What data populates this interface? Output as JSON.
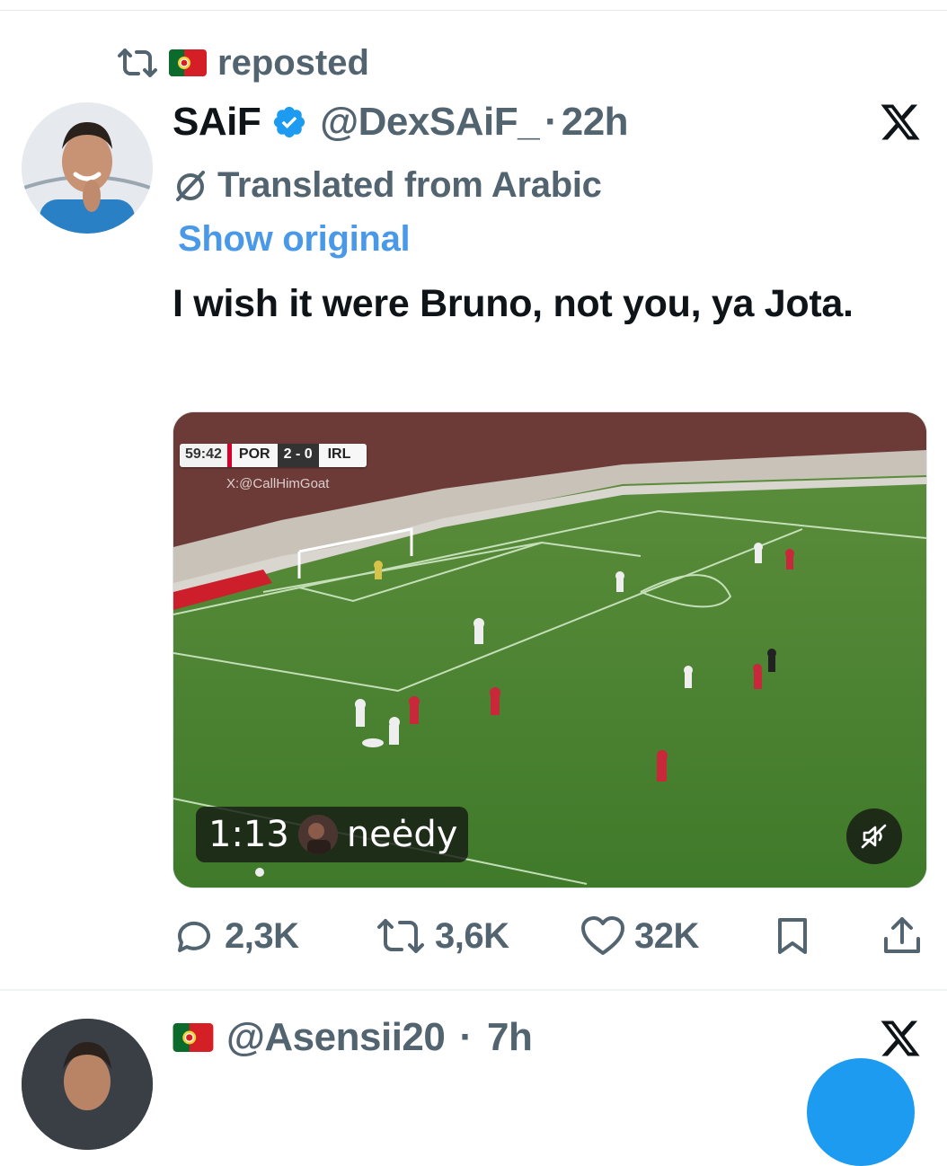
{
  "repost": {
    "label": "reposted",
    "flag": "Portugal flag"
  },
  "post": {
    "display_name": "SAiF",
    "handle": "@DexSAiF_",
    "separator": "·",
    "time": "22h",
    "translated_label": "Translated from Arabic",
    "show_original_label": "Show original",
    "text": "I wish it were Bruno, not you, ya Jota.",
    "media": {
      "scorebug": {
        "clock": "59:42",
        "home": "POR",
        "score": "2 - 0",
        "away": "IRL"
      },
      "credit": "X:@CallHimGoat",
      "duration": "1:13",
      "overlay_user": "neėdy",
      "muted": true
    },
    "actions": {
      "replies": "2,3K",
      "reposts": "3,6K",
      "likes": "32K"
    }
  },
  "next_post": {
    "flag": "Portugal flag",
    "handle": "@Asensii20",
    "separator": "·",
    "time": "7h"
  },
  "colors": {
    "secondary_text": "#536471",
    "link_blue": "#4a99e9",
    "verified_blue": "#1d9bf0",
    "primary_text": "#0f1419"
  }
}
